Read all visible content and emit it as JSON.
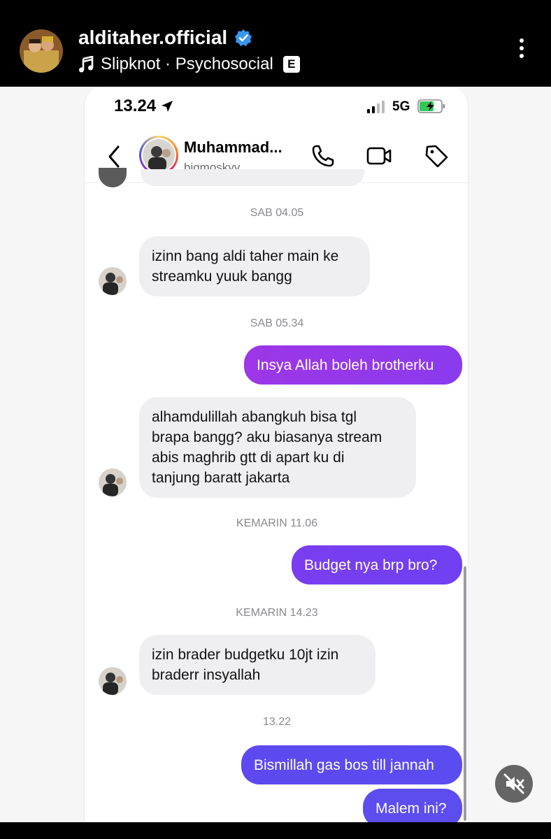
{
  "story": {
    "username": "alditaher.official",
    "music": "Slipknot · Psychosocial",
    "explicit_badge": "E"
  },
  "status_bar": {
    "time": "13.24",
    "network": "5G"
  },
  "chat": {
    "name": "Muhammad...",
    "handle": "bigmoskyy",
    "messages": [
      {
        "kind": "timestamp",
        "text": "SAB 04.05"
      },
      {
        "kind": "in",
        "lines": [
          "izinn bang aldi taher main ke",
          "streamku yuuk bangg"
        ]
      },
      {
        "kind": "timestamp",
        "text": "SAB 05.34"
      },
      {
        "kind": "out",
        "text": "Insya Allah boleh brotherku"
      },
      {
        "kind": "in",
        "lines": [
          "alhamdulillah abangkuh bisa tgl",
          "brapa bangg? aku biasanya stream",
          "abis maghrib gtt di apart ku di",
          "tanjung baratt jakarta"
        ]
      },
      {
        "kind": "timestamp",
        "text": "KEMARIN 11.06"
      },
      {
        "kind": "out",
        "text": "Budget nya brp bro?"
      },
      {
        "kind": "timestamp",
        "text": "KEMARIN 14.23"
      },
      {
        "kind": "in",
        "lines": [
          "izin brader budgetku 10jt izin",
          "braderr insyallah"
        ]
      },
      {
        "kind": "timestamp",
        "text": "13.22"
      },
      {
        "kind": "out",
        "text": "Bismillah gas bos till jannah"
      },
      {
        "kind": "out",
        "text": "Malem ini?"
      }
    ]
  },
  "colors": {
    "outgoing_gradient_start": "#9b36e8",
    "outgoing_gradient_end": "#5b4cf0",
    "incoming_bubble": "#efeff1",
    "verified_blue": "#3897f0"
  }
}
